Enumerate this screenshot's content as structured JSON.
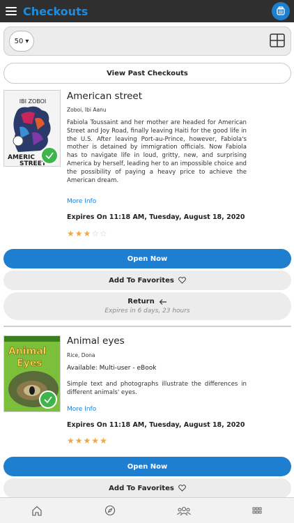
{
  "app": {
    "title": "Checkouts"
  },
  "filter": {
    "page_size": "50",
    "page_size_caret": "▾"
  },
  "past_checkouts_label": "View Past Checkouts",
  "books": [
    {
      "title": "American street",
      "author": "Zoboi, Ibi Aanu",
      "cover_author": "IBI ZOBOI",
      "cover_title_1": "AMERIC",
      "cover_title_2": "STREET",
      "description": "Fabiola Toussaint and her mother are headed for American Street and Joy Road, finally leaving Haiti for the good life in the U.S. After leaving Port-au-Prince, however, Fabiola's mother is detained by immigration officials. Now Fabiola has to navigate life in loud, gritty, new, and surprising America by herself, leading her to an impossible choice and the possibility of paying a heavy price to achieve the American dream.",
      "more_info": "More Info",
      "expires": "Expires On 11:18 AM, Tuesday, August 18, 2020",
      "rating": 3,
      "open_label": "Open Now",
      "favorites_label": "Add To Favorites",
      "return_label": "Return",
      "return_sub": "Expires in 6 days, 23 hours"
    },
    {
      "title": "Animal eyes",
      "author": "Rice, Dona",
      "cover_title_1": "Animal",
      "cover_title_2": "Eyes",
      "availability": "Available: Multi-user - eBook",
      "description": "Simple text and photographs illustrate the differences in different animals' eyes.",
      "more_info": "More Info",
      "expires": "Expires On 11:18 AM, Tuesday, August 18, 2020",
      "rating": 5,
      "open_label": "Open Now",
      "favorites_label": "Add To Favorites"
    }
  ],
  "colors": {
    "accent": "#1e7fd1",
    "title": "#1e8ce0",
    "star": "#f0a742",
    "badge": "#3eb54a",
    "topbar": "#2f2f2f"
  },
  "bottom_nav": [
    "home-icon",
    "explore-icon",
    "community-icon",
    "apps-icon"
  ]
}
